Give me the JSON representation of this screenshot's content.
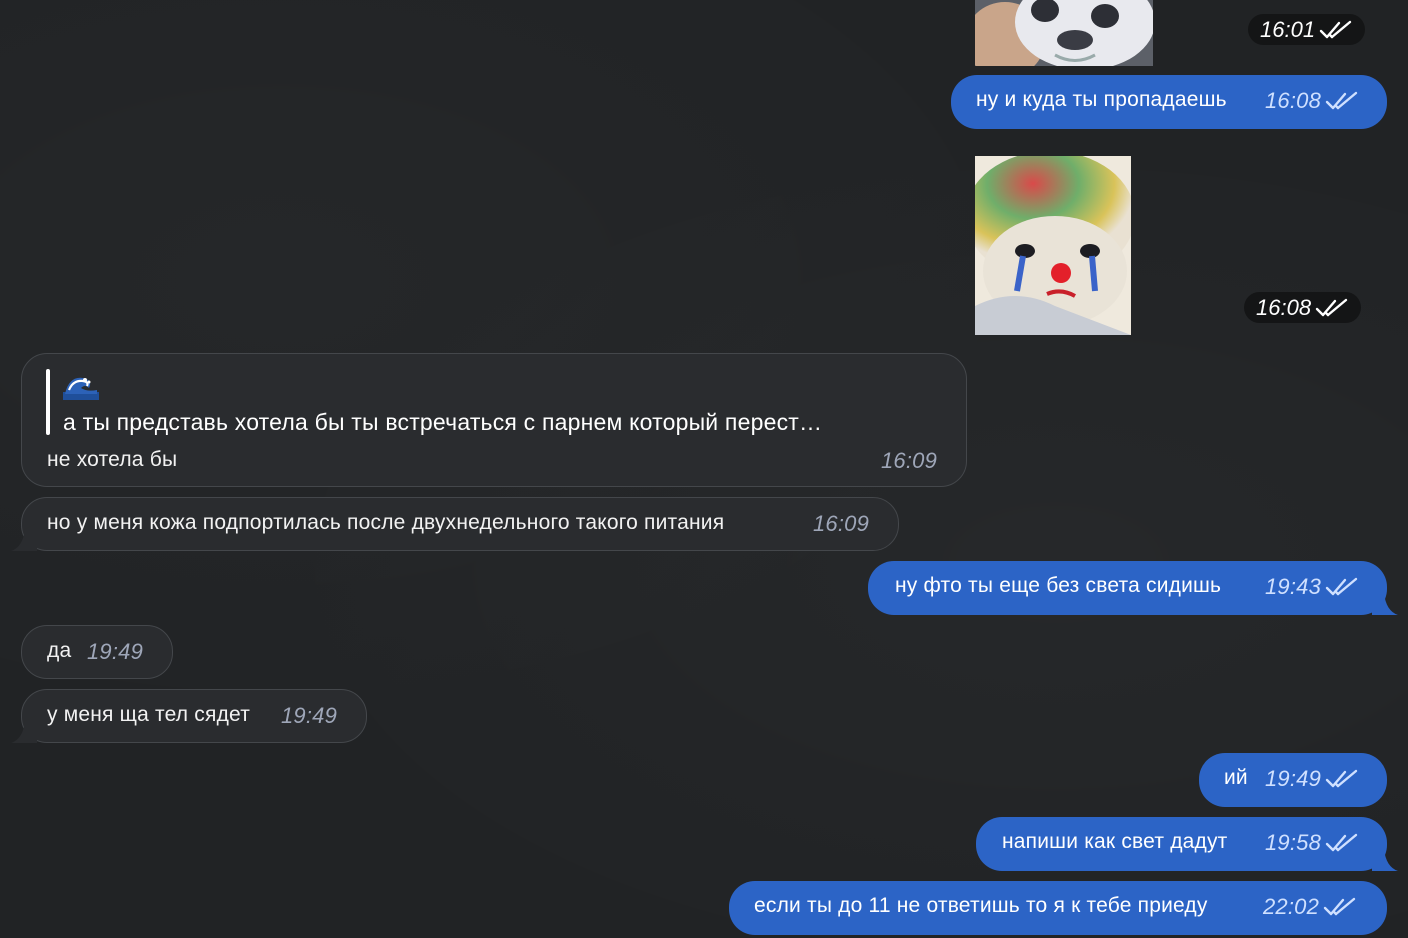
{
  "messages": {
    "m1": {
      "time": "16:01"
    },
    "m2": {
      "text": "ну и куда ты пропадаешь",
      "time": "16:08"
    },
    "m3": {
      "time": "16:08"
    },
    "m4": {
      "quote_text": "а ты представь хотела бы ты встречаться с парнем который перест…",
      "text": "не хотела бы",
      "time": "16:09"
    },
    "m5": {
      "text": "но у меня кожа подпортилась после двухнедельного такого питания",
      "time": "16:09"
    },
    "m6": {
      "text": "ну фто ты еще без света сидишь",
      "time": "19:43"
    },
    "m7": {
      "text": "да",
      "time": "19:49"
    },
    "m8": {
      "text": "у меня ща тел сядет",
      "time": "19:49"
    },
    "m9": {
      "text": "ий",
      "time": "19:49"
    },
    "m10": {
      "text": "напиши как свет дадут",
      "time": "19:58"
    },
    "m11": {
      "text": "если ты до 11 не ответишь то я к тебе приеду",
      "time": "22:02"
    }
  },
  "colors": {
    "background": "#212325",
    "incoming_bubble": "#2a2c2f",
    "outgoing_bubble": "#2c64c6",
    "timestamp_badge": "#141516"
  },
  "icons": {
    "read_receipt": "double-check-icon",
    "quote_emoji": "wave-emoji-icon"
  }
}
